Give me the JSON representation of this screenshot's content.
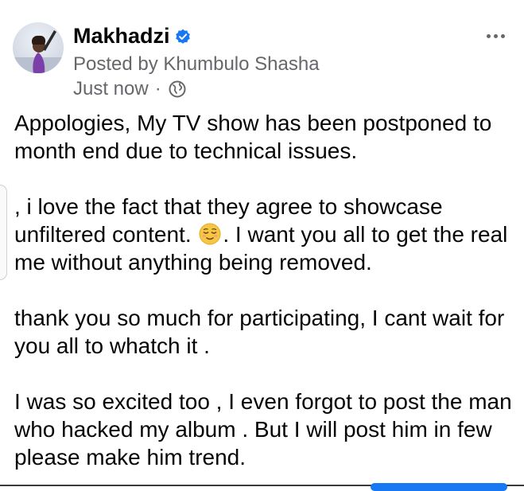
{
  "post": {
    "author_name": "Makhadzi",
    "posted_by": "Posted by Khumbulo Shasha",
    "time": "Just now",
    "separator": "·",
    "paragraph1": "Appologies, My TV show has been postponed to month end due to technical issues.",
    "paragraph2_before_emoji": ", i love the fact that they agree to showcase unfiltered content.",
    "paragraph2_after_emoji": ". I want you all to get the real me without anything being removed.",
    "paragraph3": "thank you so much for participating, I cant wait for you all to whatch it .",
    "paragraph4": "I was so excited too , I even forgot to post the man who hacked my album . But I will post him in few please make him trend."
  },
  "icons": {
    "verified": "verified-badge-icon",
    "audience": "globe-icon",
    "more": "more-options-icon",
    "emoji": "relieved-face-emoji"
  },
  "colors": {
    "verified_blue": "#1877f2",
    "secondary_text": "#65676b",
    "primary_text": "#050505"
  }
}
